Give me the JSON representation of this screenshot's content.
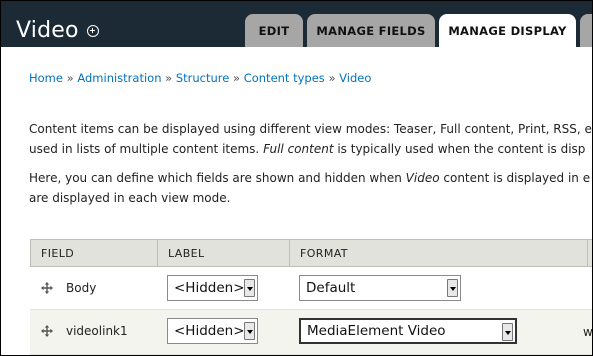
{
  "header": {
    "title": "Video",
    "shortcut_icon": "plus-circle-icon",
    "tabs": [
      {
        "label": "EDIT",
        "active": false
      },
      {
        "label": "MANAGE FIELDS",
        "active": false
      },
      {
        "label": "MANAGE DISPLAY",
        "active": true
      }
    ]
  },
  "breadcrumb": [
    {
      "label": "Home"
    },
    {
      "label": "Administration"
    },
    {
      "label": "Structure"
    },
    {
      "label": "Content types"
    },
    {
      "label": "Video"
    }
  ],
  "breadcrumb_separator": "»",
  "description": {
    "p1_line1": "Content items can be displayed using different view modes: Teaser, Full content, Print, RSS, e",
    "p1_line2_a": "used in lists of multiple content items. ",
    "p1_line2_em": "Full content",
    "p1_line2_b": " is typically used when the content is disp",
    "p2_line1_a": "Here, you can define which fields are shown and hidden when ",
    "p2_line1_em": "Video",
    "p2_line1_b": " content is displayed in e",
    "p2_line2": "are displayed in each view mode."
  },
  "table": {
    "headers": {
      "field": "FIELD",
      "label": "LABEL",
      "format": "FORMAT"
    },
    "rows": [
      {
        "field": "Body",
        "label": "<Hidden>",
        "format": "Default",
        "extra": ""
      },
      {
        "field": "videolink1",
        "label": "<Hidden>",
        "format": "MediaElement Video",
        "extra": "w"
      }
    ]
  },
  "colors": {
    "header_bg": "#1c2a36",
    "tab_bg": "#a6a6a6",
    "link": "#0074bd",
    "table_header_bg": "#e1e2dc"
  }
}
